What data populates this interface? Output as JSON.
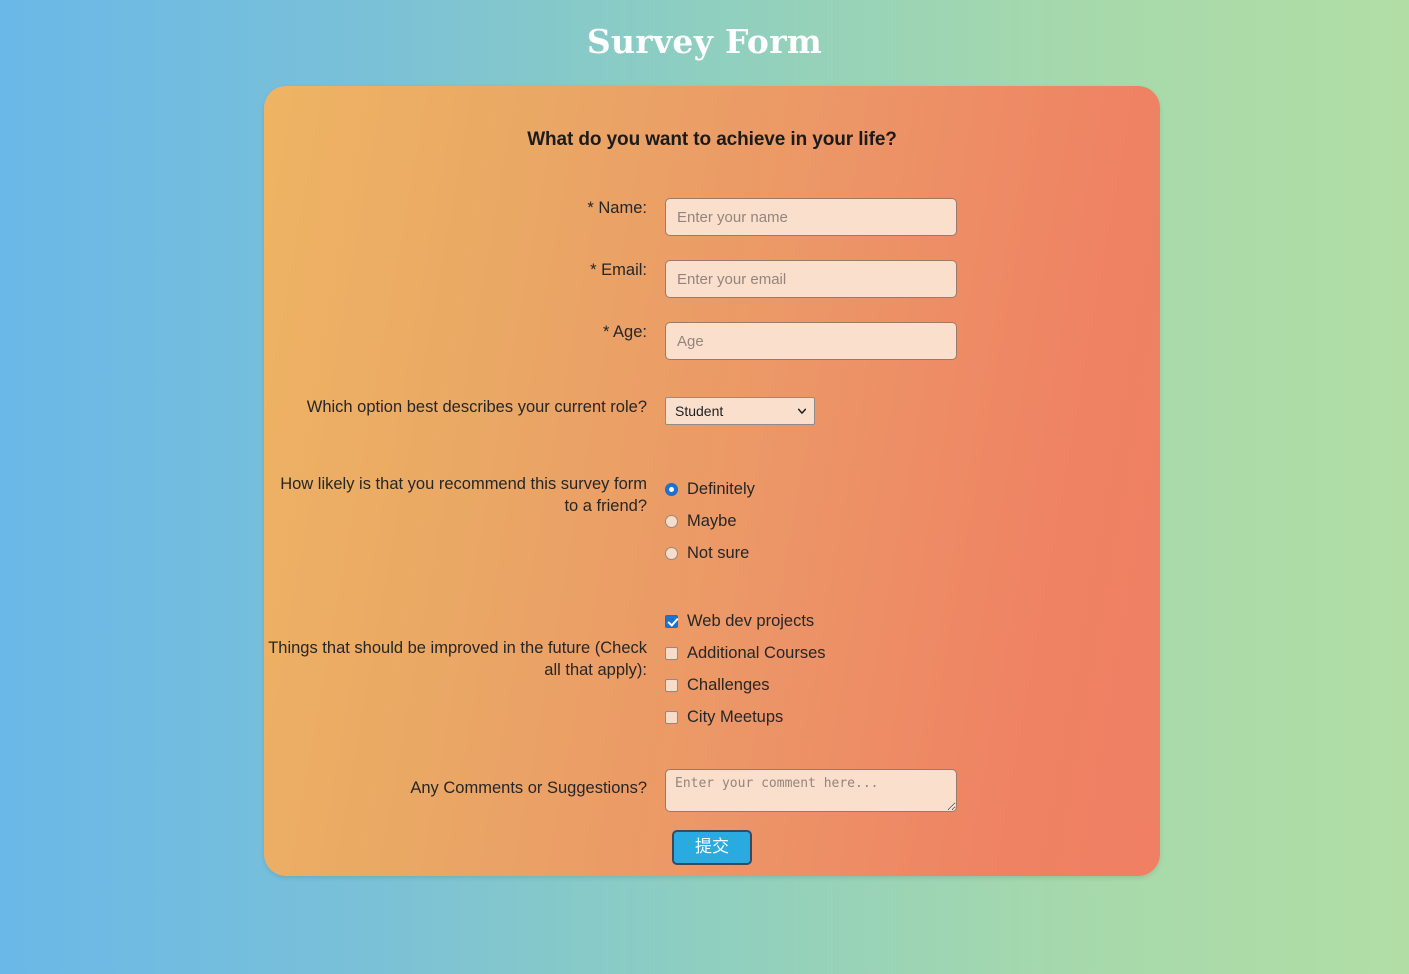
{
  "page": {
    "title": "Survey Form"
  },
  "form": {
    "heading": "What do you want to achieve in your life?",
    "fields": {
      "name": {
        "label": "* Name:",
        "placeholder": "Enter your name",
        "value": ""
      },
      "email": {
        "label": "* Email:",
        "placeholder": "Enter your email",
        "value": ""
      },
      "age": {
        "label": "* Age:",
        "placeholder": "Age",
        "value": ""
      },
      "role": {
        "label": "Which option best describes your current role?",
        "selected": "Student",
        "options": [
          "Student"
        ]
      },
      "recommend": {
        "label": "How likely is that you recommend this survey form to a friend?",
        "options": [
          {
            "label": "Definitely",
            "checked": true
          },
          {
            "label": "Maybe",
            "checked": false
          },
          {
            "label": "Not sure",
            "checked": false
          }
        ]
      },
      "improve": {
        "label": "Things that should be improved in the future (Check all that apply):",
        "options": [
          {
            "label": "Web dev projects",
            "checked": true
          },
          {
            "label": "Additional Courses",
            "checked": false
          },
          {
            "label": "Challenges",
            "checked": false
          },
          {
            "label": "City Meetups",
            "checked": false
          }
        ]
      },
      "comments": {
        "label": "Any Comments or Suggestions?",
        "placeholder": "Enter your comment here...",
        "value": ""
      }
    },
    "submit_label": "提交"
  },
  "colors": {
    "background_start": "#6ab8e8",
    "background_end": "#b2dea5",
    "card_start": "#eeb463",
    "card_end": "#f07f63",
    "input_background": "#fadfcd",
    "accent_checked": "#1b73d2",
    "submit_background": "#29abe2",
    "title_text": "#ffffff"
  }
}
